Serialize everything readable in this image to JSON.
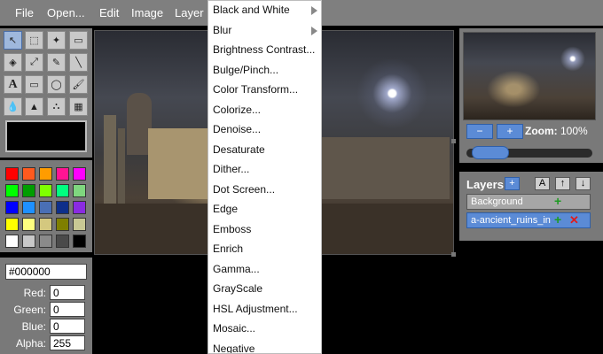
{
  "menubar": {
    "items": [
      "File",
      "Open...",
      "Edit",
      "Image",
      "Layer"
    ]
  },
  "tools": [
    {
      "icon": "pointer-icon",
      "glyph": "↖"
    },
    {
      "icon": "marquee-select-icon",
      "glyph": "⬚"
    },
    {
      "icon": "magic-wand-icon",
      "glyph": "✦"
    },
    {
      "icon": "eraser-icon",
      "glyph": "▭"
    },
    {
      "icon": "paint-bucket-icon",
      "glyph": "◈"
    },
    {
      "icon": "eyedropper-icon",
      "glyph": "⤢"
    },
    {
      "icon": "pencil-icon",
      "glyph": "✎"
    },
    {
      "icon": "line-icon",
      "glyph": "╲"
    },
    {
      "icon": "text-tool-icon",
      "glyph": "A"
    },
    {
      "icon": "rectangle-icon",
      "glyph": "▭"
    },
    {
      "icon": "ellipse-icon",
      "glyph": "◯"
    },
    {
      "icon": "brush-icon",
      "glyph": "🖌"
    },
    {
      "icon": "blur-drop-icon",
      "glyph": "💧"
    },
    {
      "icon": "sharpen-icon",
      "glyph": "▲"
    },
    {
      "icon": "stamp-icon",
      "glyph": "⛬"
    },
    {
      "icon": "gradient-icon",
      "glyph": "▦"
    }
  ],
  "palette": [
    "#ff0000",
    "#ff5a1e",
    "#ff9c00",
    "#ff1493",
    "#ff00ff",
    "#00ff00",
    "#009d00",
    "#7fff00",
    "#00ff7f",
    "#7fd67f",
    "#0000ff",
    "#1e90ff",
    "#4a6fb5",
    "#0e2f8a",
    "#8a2be2",
    "#ffff00",
    "#ffff7f",
    "#d4c87f",
    "#7f7f00",
    "#c8c894",
    "#ffffff",
    "#c8c8c8",
    "#8a8a8a",
    "#4a4a4a",
    "#000000"
  ],
  "color": {
    "hex": "#000000",
    "red_label": "Red:",
    "red": "0",
    "green_label": "Green:",
    "green": "0",
    "blue_label": "Blue:",
    "blue": "0",
    "alpha_label": "Alpha:",
    "alpha": "255"
  },
  "navigator": {
    "zoom_out": "−",
    "zoom_in": "+",
    "zoom_label": "Zoom:",
    "zoom_value": "100%",
    "zoom_slider_level": 0.25
  },
  "layers": {
    "title": "Layers",
    "add_btn": "+",
    "rename_btn": "A",
    "up_btn": "↑",
    "down_btn": "↓",
    "items": [
      {
        "name": "Background"
      },
      {
        "name": "a-ancient_ruins_in"
      }
    ]
  },
  "dropdown": {
    "items": [
      "Black and White",
      "Blur",
      "Brightness Contrast...",
      "Bulge/Pinch...",
      "Color Transform...",
      "Colorize...",
      "Denoise...",
      "Desaturate",
      "Dither...",
      "Dot Screen...",
      "Edge",
      "Emboss",
      "Enrich",
      "Gamma...",
      "GrayScale",
      "HSL Adjustment...",
      "Mosaic...",
      "Negative"
    ]
  },
  "colors": {
    "menubar_bg": "#7f7f7f",
    "panel_bg": "#797979",
    "accent_blue": "#5b8bd6",
    "add_green": "#1d9b22",
    "delete_red": "#e01b1b"
  }
}
